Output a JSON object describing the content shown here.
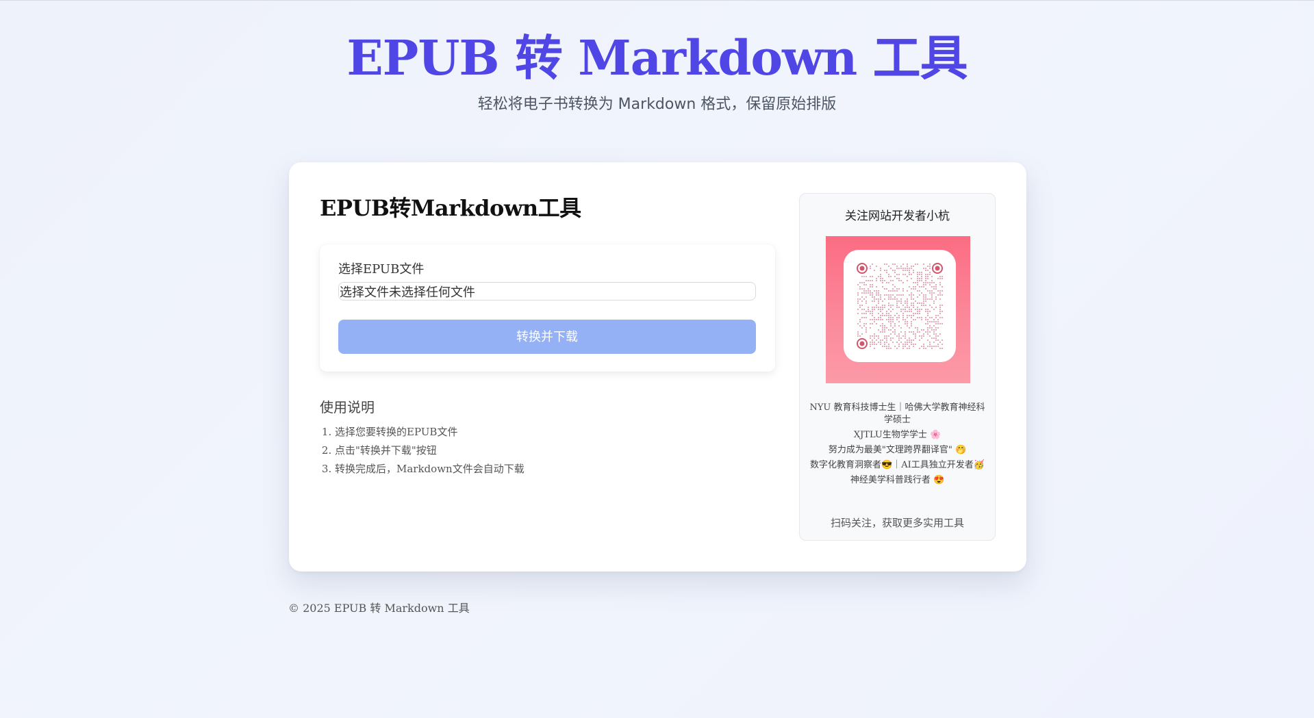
{
  "hero": {
    "title": "EPUB 转 Markdown 工具",
    "subtitle": "轻松将电子书转换为 Markdown 格式，保留原始排版"
  },
  "card": {
    "title": "EPUB转Markdown工具",
    "form": {
      "label": "选择EPUB文件",
      "file_button": "选择文件",
      "file_status": "未选择任何文件",
      "convert_label": "转换并下载"
    },
    "instructions": {
      "heading": "使用说明",
      "steps": [
        "选择您要转换的EPUB文件",
        "点击\"转换并下载\"按钮",
        "转换完成后，Markdown文件会自动下载"
      ]
    }
  },
  "side": {
    "title": "关注网站开发者小杭",
    "qr_icon": "qr-code-icon",
    "bio": [
      "NYU 教育科技博士生｜哈佛大学教育神经科学硕士",
      "XJTLU生物学学士 🌸",
      "努力成为最美\"文理跨界翻译官\" 🤭",
      "数字化教育洞察者😎｜AI工具独立开发者🥳",
      "神经美学科普践行者 😍"
    ],
    "footer": "扫码关注，获取更多实用工具"
  },
  "footer": {
    "copyright": "© 2025 EPUB 转 Markdown 工具"
  },
  "colors": {
    "accent": "#4f46e5",
    "button": "#93b1f4",
    "qr_bg": "#fc6c83"
  }
}
